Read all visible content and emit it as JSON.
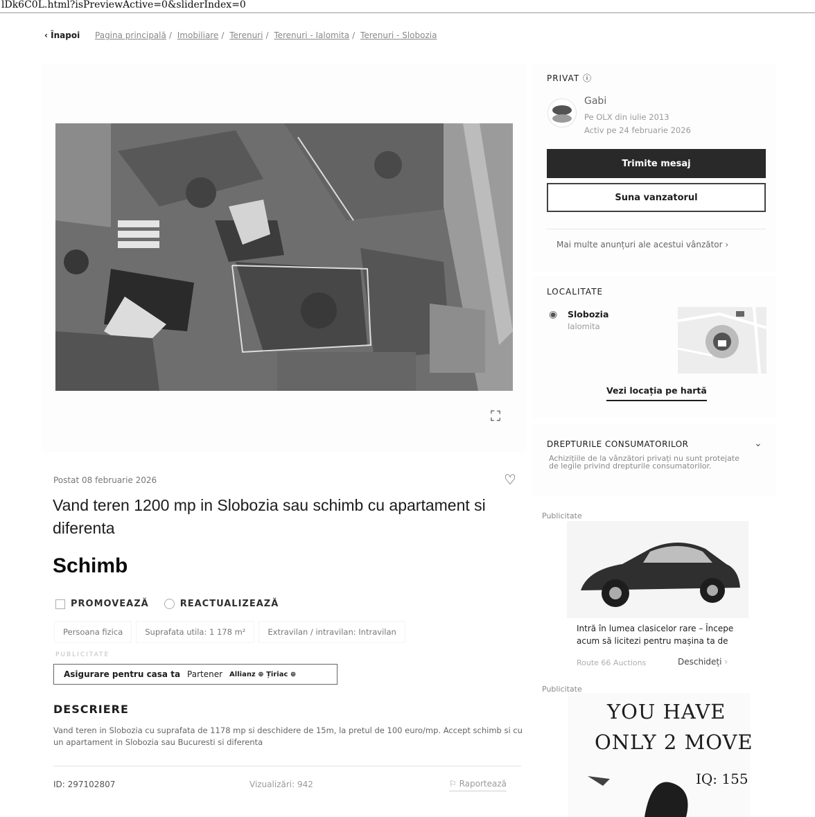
{
  "browser": {
    "url_fragment": "lDk6C0L.html?isPreviewActive=0&sliderIndex=0"
  },
  "breadcrumb": {
    "back": "Înapoi",
    "items": [
      "Pagina principală",
      "Imobiliare",
      "Terenuri",
      "Terenuri - Ialomita",
      "Terenuri - Slobozia"
    ]
  },
  "listing": {
    "posted": "Postat 08 februarie 2026",
    "title": "Vand teren 1200 mp in Slobozia sau schimb cu apartament si diferenta",
    "price": "Schimb",
    "promote": "PROMOVEAZĂ",
    "refresh": "REACTUALIZEAZĂ",
    "tags": [
      "Persoana fizica",
      "Suprafata utila: 1 178 m²",
      "Extravilan / intravilan: Intravilan"
    ],
    "ad_label": "PUBLICITATE",
    "insurance": {
      "text": "Asigurare pentru casa ta",
      "partner": "Partener",
      "brand": "Allianz ⊕ Țiriac ⊕"
    },
    "description_heading": "DESCRIERE",
    "description": "Vand teren in Slobozia cu suprafata de 1178 mp si deschidere de 15m, la pretul de 100 euro/mp. Accept schimb si cu un apartament in Slobozia sau Bucuresti si diferenta",
    "id": "ID: 297102807",
    "views": "Vizualizări: 942",
    "report": "Raportează"
  },
  "seller": {
    "type": "PRIVAT",
    "name": "Gabi",
    "since": "Pe OLX din iulie 2013",
    "active": "Activ pe 24 februarie 2026",
    "message_button": "Trimite mesaj",
    "call_button": "Suna vanzatorul",
    "more_ads": "Mai multe anunțuri ale acestui vânzător"
  },
  "location": {
    "heading": "LOCALITATE",
    "city": "Slobozia",
    "county": "Ialomita",
    "map_link": "Vezi locația pe hartă"
  },
  "consumer_rights": {
    "heading": "DREPTURILE CONSUMATORILOR",
    "text": "Achizițiile de la vânzători privați nu sunt protejate de legile privind drepturile consumatorilor."
  },
  "ads": {
    "label": "Publicitate",
    "ad1_text": "Intră în lumea clasicelor rare – Începe acum să licitezi pentru mașina ta de",
    "ad1_source": "Route 66 Auctions",
    "ad1_open": "Deschideți",
    "ad2_line1": "YOU HAVE",
    "ad2_line2": "ONLY 2 MOVE",
    "ad2_iq": "IQ: 155"
  }
}
